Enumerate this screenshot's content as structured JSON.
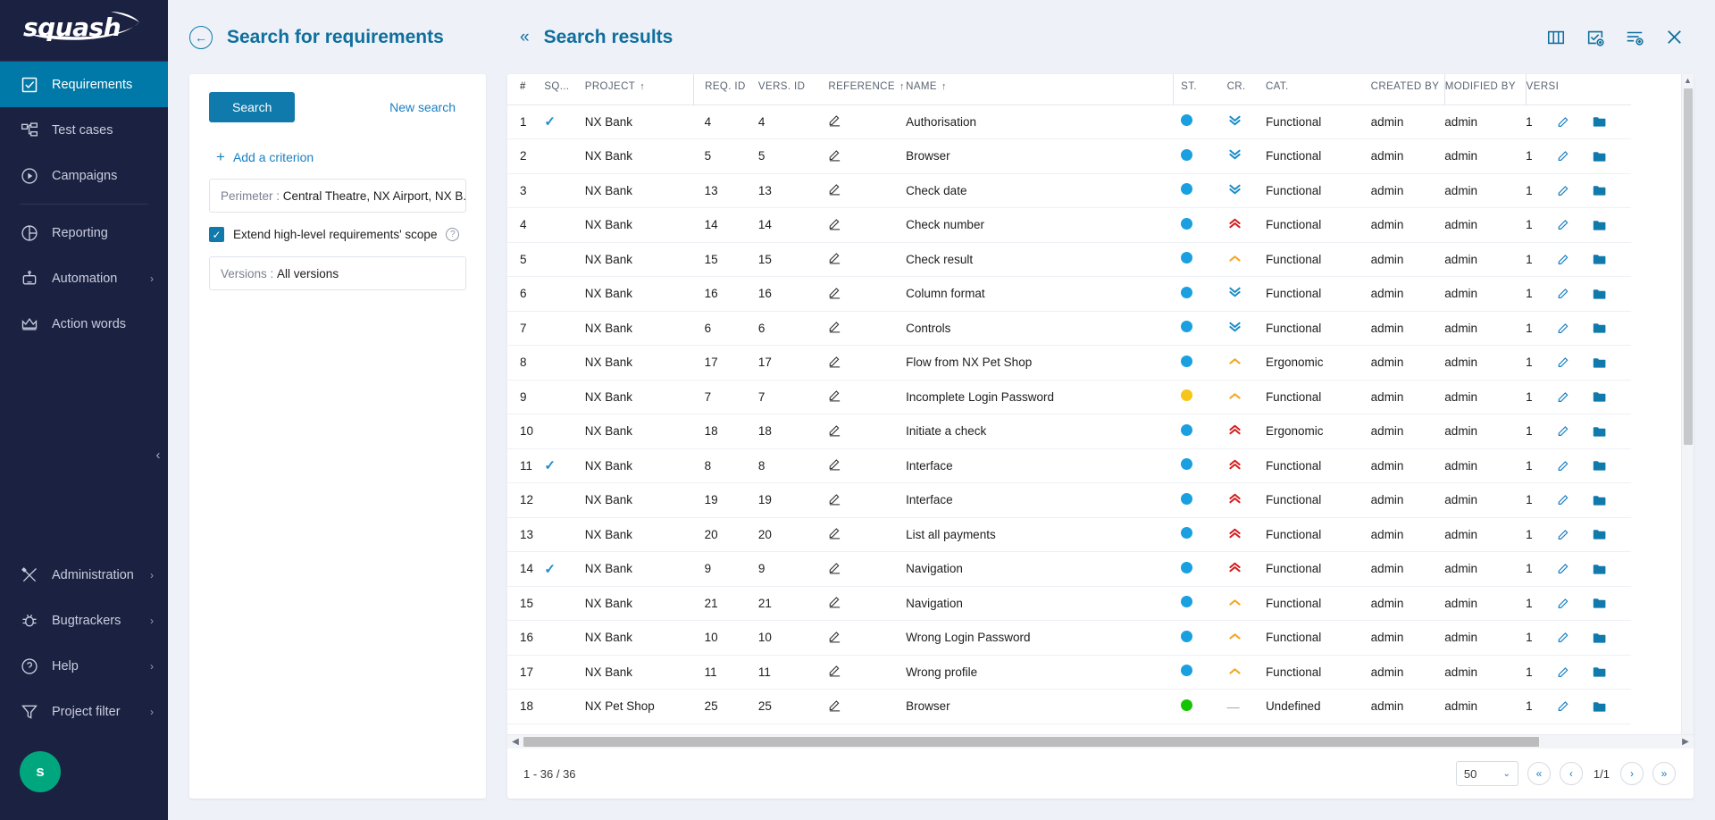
{
  "sidebar": {
    "logo": "squash",
    "items": [
      {
        "label": "Requirements",
        "icon": "checkbox-square-icon",
        "active": true,
        "expandable": false
      },
      {
        "label": "Test cases",
        "icon": "tree-nodes-icon",
        "active": false,
        "expandable": false
      },
      {
        "label": "Campaigns",
        "icon": "play-circle-icon",
        "active": false,
        "expandable": false
      },
      {
        "label": "Reporting",
        "icon": "pie-chart-icon",
        "active": false,
        "expandable": false
      },
      {
        "label": "Automation",
        "icon": "robot-icon",
        "active": false,
        "expandable": true
      },
      {
        "label": "Action words",
        "icon": "crown-icon",
        "active": false,
        "expandable": false
      }
    ],
    "bottom_items": [
      {
        "label": "Administration",
        "icon": "tools-icon",
        "expandable": true
      },
      {
        "label": "Bugtrackers",
        "icon": "bug-icon",
        "expandable": true
      },
      {
        "label": "Help",
        "icon": "help-circle-icon",
        "expandable": true
      },
      {
        "label": "Project filter",
        "icon": "funnel-icon",
        "expandable": true
      }
    ],
    "avatar_initial": "s",
    "collapse_icon": "chevron-left-icon"
  },
  "header": {
    "back_icon": "arrow-left-circle-icon",
    "search_panel_title": "Search for requirements",
    "collapse_results_icon": "double-chevron-left-icon",
    "results_title": "Search results",
    "toolbar": [
      {
        "name": "columns-icon",
        "title": "Columns"
      },
      {
        "name": "add-testcase-icon",
        "title": "Add test case"
      },
      {
        "name": "filter-add-icon",
        "title": "Filter"
      },
      {
        "name": "close-icon",
        "title": "Close"
      }
    ]
  },
  "search_panel": {
    "search_button": "Search",
    "new_search_link": "New search",
    "add_criterion": "Add a criterion",
    "plus_icon": "plus-icon",
    "criteria": [
      {
        "label": "Perimeter :",
        "value": "Central Theatre, NX Airport, NX B..."
      },
      {
        "label": "Versions :",
        "value": "All versions"
      }
    ],
    "checkbox": {
      "checked": true,
      "label": "Extend high-level requirements' scope",
      "help_icon": "help-circle-icon"
    }
  },
  "table": {
    "columns": [
      {
        "key": "num",
        "label": "#",
        "sortable": false,
        "sorted": false
      },
      {
        "key": "sq",
        "label": "SQ...",
        "sortable": false,
        "sorted": false
      },
      {
        "key": "project",
        "label": "PROJECT",
        "sortable": true,
        "sorted": true
      },
      {
        "key": "req_id",
        "label": "REQ. ID",
        "sortable": false,
        "sorted": false
      },
      {
        "key": "vers_id",
        "label": "VERS. ID",
        "sortable": false,
        "sorted": false
      },
      {
        "key": "reference",
        "label": "REFERENCE",
        "sortable": true,
        "sorted": true
      },
      {
        "key": "name",
        "label": "NAME",
        "sortable": true,
        "sorted": true
      },
      {
        "key": "status",
        "label": "ST.",
        "sortable": false,
        "sorted": false
      },
      {
        "key": "crit",
        "label": "CR.",
        "sortable": false,
        "sorted": false
      },
      {
        "key": "cat",
        "label": "CAT.",
        "sortable": false,
        "sorted": false
      },
      {
        "key": "created",
        "label": "CREATED BY",
        "sortable": false,
        "sorted": false
      },
      {
        "key": "modified",
        "label": "MODIFIED BY",
        "sortable": false,
        "sorted": false
      },
      {
        "key": "versions",
        "label": "VERSI",
        "sortable": false,
        "sorted": false
      }
    ],
    "sort_arrow": "↑",
    "rows": [
      {
        "num": "1",
        "sq": true,
        "project": "NX Bank",
        "req_id": "4",
        "vers_id": "4",
        "reference": "",
        "name": "Authorisation",
        "status": "blue",
        "crit": "low",
        "cat": "Functional",
        "created": "admin",
        "modified": "admin",
        "versions": "1"
      },
      {
        "num": "2",
        "sq": false,
        "project": "NX Bank",
        "req_id": "5",
        "vers_id": "5",
        "reference": "",
        "name": "Browser",
        "status": "blue",
        "crit": "low",
        "cat": "Functional",
        "created": "admin",
        "modified": "admin",
        "versions": "1"
      },
      {
        "num": "3",
        "sq": false,
        "project": "NX Bank",
        "req_id": "13",
        "vers_id": "13",
        "reference": "",
        "name": "Check date",
        "status": "blue",
        "crit": "low",
        "cat": "Functional",
        "created": "admin",
        "modified": "admin",
        "versions": "1"
      },
      {
        "num": "4",
        "sq": false,
        "project": "NX Bank",
        "req_id": "14",
        "vers_id": "14",
        "reference": "",
        "name": "Check number",
        "status": "blue",
        "crit": "high",
        "cat": "Functional",
        "created": "admin",
        "modified": "admin",
        "versions": "1"
      },
      {
        "num": "5",
        "sq": false,
        "project": "NX Bank",
        "req_id": "15",
        "vers_id": "15",
        "reference": "",
        "name": "Check result",
        "status": "blue",
        "crit": "medium",
        "cat": "Functional",
        "created": "admin",
        "modified": "admin",
        "versions": "1"
      },
      {
        "num": "6",
        "sq": false,
        "project": "NX Bank",
        "req_id": "16",
        "vers_id": "16",
        "reference": "",
        "name": "Column format",
        "status": "blue",
        "crit": "low",
        "cat": "Functional",
        "created": "admin",
        "modified": "admin",
        "versions": "1"
      },
      {
        "num": "7",
        "sq": false,
        "project": "NX Bank",
        "req_id": "6",
        "vers_id": "6",
        "reference": "",
        "name": "Controls",
        "status": "blue",
        "crit": "low",
        "cat": "Functional",
        "created": "admin",
        "modified": "admin",
        "versions": "1"
      },
      {
        "num": "8",
        "sq": false,
        "project": "NX Bank",
        "req_id": "17",
        "vers_id": "17",
        "reference": "",
        "name": "Flow from NX Pet Shop",
        "status": "blue",
        "crit": "medium",
        "cat": "Ergonomic",
        "created": "admin",
        "modified": "admin",
        "versions": "1"
      },
      {
        "num": "9",
        "sq": false,
        "project": "NX Bank",
        "req_id": "7",
        "vers_id": "7",
        "reference": "",
        "name": "Incomplete Login Password",
        "status": "yellow",
        "crit": "medium",
        "cat": "Functional",
        "created": "admin",
        "modified": "admin",
        "versions": "1"
      },
      {
        "num": "10",
        "sq": false,
        "project": "NX Bank",
        "req_id": "18",
        "vers_id": "18",
        "reference": "",
        "name": "Initiate a check",
        "status": "blue",
        "crit": "high",
        "cat": "Ergonomic",
        "created": "admin",
        "modified": "admin",
        "versions": "1"
      },
      {
        "num": "11",
        "sq": true,
        "project": "NX Bank",
        "req_id": "8",
        "vers_id": "8",
        "reference": "",
        "name": "Interface",
        "status": "blue",
        "crit": "high",
        "cat": "Functional",
        "created": "admin",
        "modified": "admin",
        "versions": "1"
      },
      {
        "num": "12",
        "sq": false,
        "project": "NX Bank",
        "req_id": "19",
        "vers_id": "19",
        "reference": "",
        "name": "Interface",
        "status": "blue",
        "crit": "high",
        "cat": "Functional",
        "created": "admin",
        "modified": "admin",
        "versions": "1"
      },
      {
        "num": "13",
        "sq": false,
        "project": "NX Bank",
        "req_id": "20",
        "vers_id": "20",
        "reference": "",
        "name": "List all payments",
        "status": "blue",
        "crit": "high",
        "cat": "Functional",
        "created": "admin",
        "modified": "admin",
        "versions": "1"
      },
      {
        "num": "14",
        "sq": true,
        "project": "NX Bank",
        "req_id": "9",
        "vers_id": "9",
        "reference": "",
        "name": "Navigation",
        "status": "blue",
        "crit": "high",
        "cat": "Functional",
        "created": "admin",
        "modified": "admin",
        "versions": "1"
      },
      {
        "num": "15",
        "sq": false,
        "project": "NX Bank",
        "req_id": "21",
        "vers_id": "21",
        "reference": "",
        "name": "Navigation",
        "status": "blue",
        "crit": "medium",
        "cat": "Functional",
        "created": "admin",
        "modified": "admin",
        "versions": "1"
      },
      {
        "num": "16",
        "sq": false,
        "project": "NX Bank",
        "req_id": "10",
        "vers_id": "10",
        "reference": "",
        "name": "Wrong Login Password",
        "status": "blue",
        "crit": "medium",
        "cat": "Functional",
        "created": "admin",
        "modified": "admin",
        "versions": "1"
      },
      {
        "num": "17",
        "sq": false,
        "project": "NX Bank",
        "req_id": "11",
        "vers_id": "11",
        "reference": "",
        "name": "Wrong profile",
        "status": "blue",
        "crit": "medium",
        "cat": "Functional",
        "created": "admin",
        "modified": "admin",
        "versions": "1"
      },
      {
        "num": "18",
        "sq": false,
        "project": "NX Pet Shop",
        "req_id": "25",
        "vers_id": "25",
        "reference": "",
        "name": "Browser",
        "status": "green",
        "crit": "none",
        "cat": "Undefined",
        "created": "admin",
        "modified": "admin",
        "versions": "1"
      }
    ]
  },
  "footer": {
    "range": "1 - 36 / 36",
    "page_size": "50",
    "page_indicator": "1/1",
    "first_icon": "«",
    "prev_icon": "‹",
    "next_icon": "›",
    "last_icon": "»"
  },
  "colors": {
    "sidebar_bg": "#1b2141",
    "accent": "#0f7aab",
    "active_nav": "#0078a8",
    "link": "#1a7fc1",
    "status_blue": "#1a9fe0",
    "status_yellow": "#f5c518",
    "status_green": "#13c400",
    "crit_high": "#d41d1d",
    "crit_medium": "#f5a623",
    "crit_low": "#1a8cc8",
    "avatar_green": "#00a77e",
    "page_bg": "#eef1f7"
  }
}
